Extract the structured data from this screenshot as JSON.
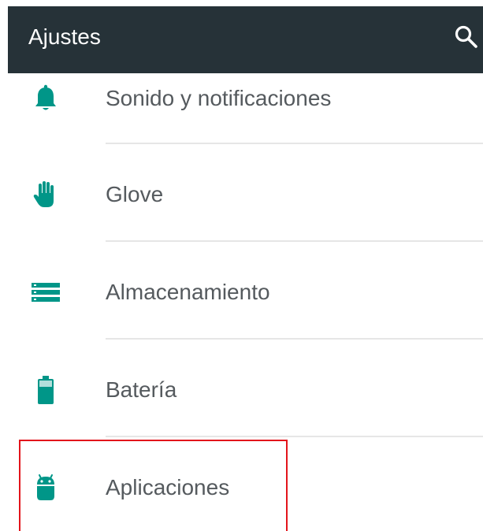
{
  "toolbar": {
    "title": "Ajustes",
    "search_icon": "search-icon"
  },
  "colors": {
    "toolbar_bg": "#263238",
    "accent": "#009688",
    "text": "#555a5e",
    "highlight": "#e3141b"
  },
  "settings": {
    "items": [
      {
        "label": "Sonido y notificaciones",
        "icon": "bell-icon"
      },
      {
        "label": "Glove",
        "icon": "hand-icon"
      },
      {
        "label": "Almacenamiento",
        "icon": "storage-icon"
      },
      {
        "label": "Batería",
        "icon": "battery-icon"
      },
      {
        "label": "Aplicaciones",
        "icon": "android-icon"
      }
    ]
  }
}
